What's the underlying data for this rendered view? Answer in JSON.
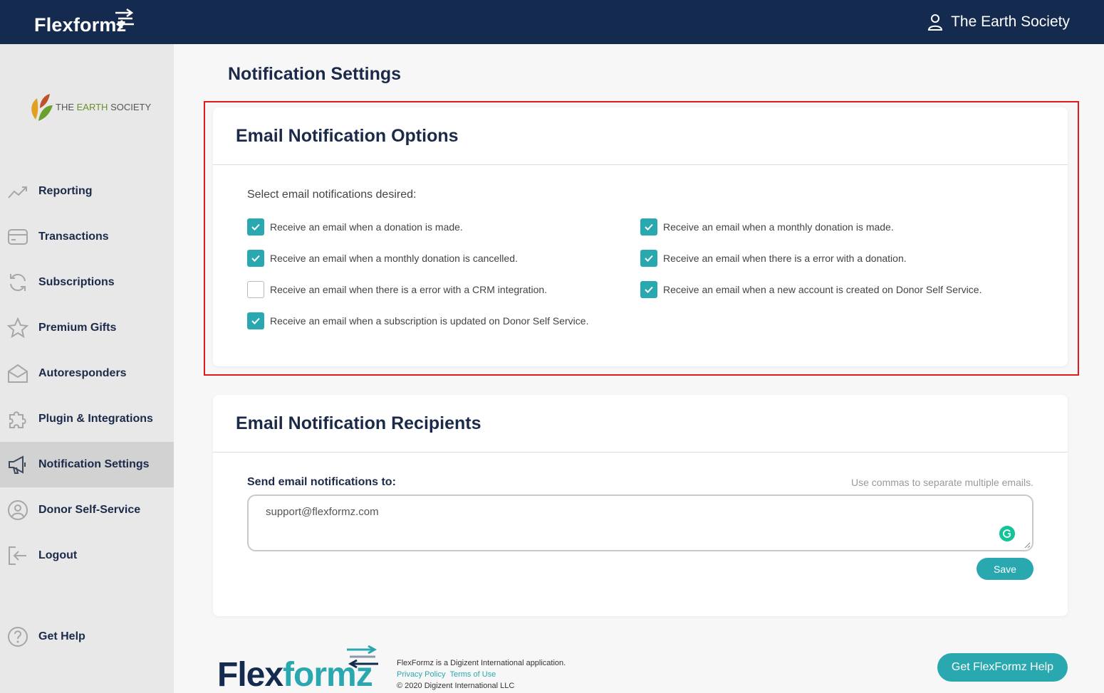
{
  "header": {
    "brand": "Flexformz",
    "user_name": "The Earth Society"
  },
  "sidebar": {
    "org_name_prefix": "THE ",
    "org_name_highlight": "EARTH",
    "org_name_suffix": " SOCIETY",
    "items": [
      {
        "label": "Reporting",
        "icon": "trending-up-icon"
      },
      {
        "label": "Transactions",
        "icon": "credit-card-icon"
      },
      {
        "label": "Subscriptions",
        "icon": "refresh-icon"
      },
      {
        "label": "Premium Gifts",
        "icon": "star-icon"
      },
      {
        "label": "Autoresponders",
        "icon": "envelope-icon"
      },
      {
        "label": "Plugin & Integrations",
        "icon": "puzzle-icon"
      },
      {
        "label": "Notification Settings",
        "icon": "megaphone-icon",
        "active": true
      },
      {
        "label": "Donor Self-Service",
        "icon": "user-circle-icon"
      },
      {
        "label": "Logout",
        "icon": "logout-icon"
      }
    ],
    "help_label": "Get Help"
  },
  "main": {
    "page_title": "Notification Settings",
    "options_card": {
      "title": "Email Notification Options",
      "select_label": "Select email notifications desired:",
      "options": [
        {
          "label": "Receive an email when a donation is made.",
          "checked": true
        },
        {
          "label": "Receive an email when a monthly donation is made.",
          "checked": true
        },
        {
          "label": "Receive an email when a monthly donation is cancelled.",
          "checked": true
        },
        {
          "label": "Receive an email when there is a error with a donation.",
          "checked": true
        },
        {
          "label": "Receive an email when there is a error with a CRM integration.",
          "checked": false
        },
        {
          "label": "Receive an email when a new account is created on Donor Self Service.",
          "checked": true
        },
        {
          "label": "Receive an email when a subscription is updated on Donor Self Service.",
          "checked": true
        }
      ]
    },
    "recipients_card": {
      "title": "Email Notification Recipients",
      "field_label": "Send email notifications to:",
      "hint": "Use commas to separate multiple emails.",
      "value": "support@flexformz.com",
      "save_label": "Save"
    }
  },
  "footer": {
    "logo_a": "Flex",
    "logo_b": "formz",
    "tagline": "FlexFormz is a Digizent International application.",
    "privacy": "Privacy Policy",
    "terms": "Terms of Use",
    "copyright": "© 2020 Digizent International LLC",
    "help_button": "Get FlexFormz Help"
  },
  "colors": {
    "navy": "#152a4f",
    "teal": "#2aa8b0",
    "highlight": "#e31a1a"
  }
}
